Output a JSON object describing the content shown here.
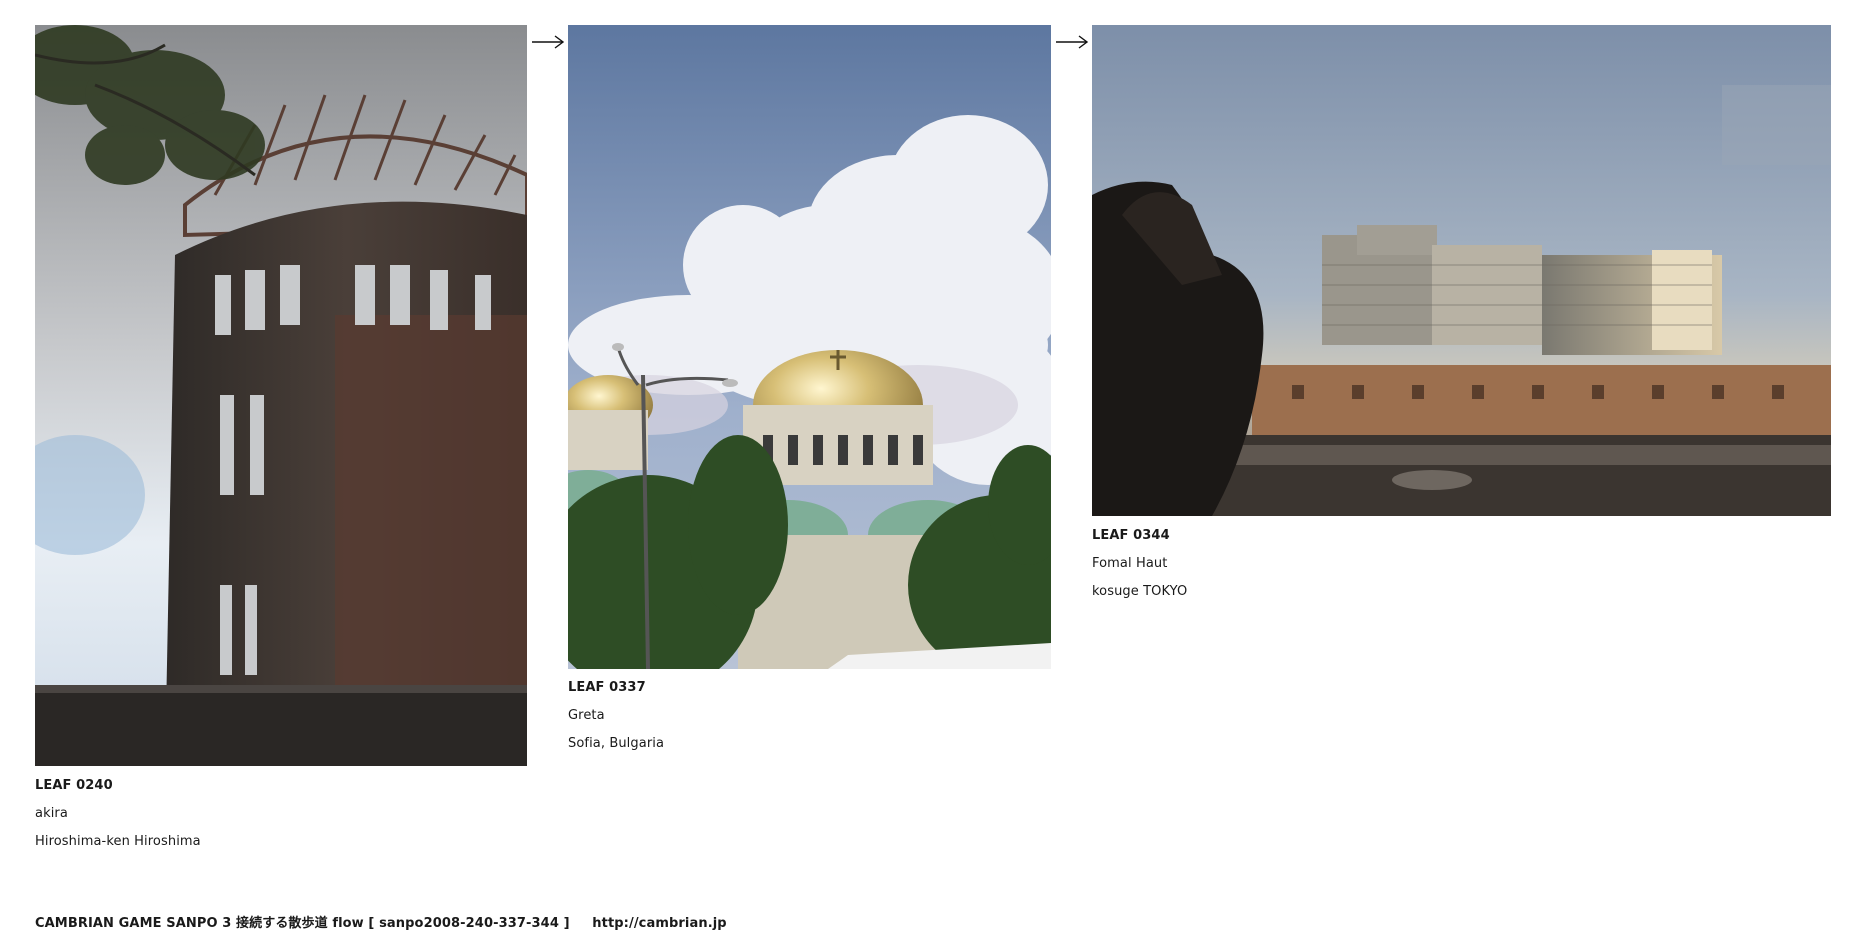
{
  "leaves": [
    {
      "id": "LEAF 0240",
      "author": "akira",
      "location": "Hiroshima-ken Hiroshima"
    },
    {
      "id": "LEAF 0337",
      "author": "Greta",
      "location": "Sofia, Bulgaria"
    },
    {
      "id": "LEAF 0344",
      "author": "Fomal Haut",
      "location": "kosuge TOKYO"
    }
  ],
  "footer": {
    "title": "CAMBRIAN GAME  SANPO 3 接続する散歩道 flow [ sanpo2008-240-337-344 ]",
    "link_text": "http://cambrian.jp"
  },
  "icons": {
    "arrow": "right-arrow-icon"
  }
}
